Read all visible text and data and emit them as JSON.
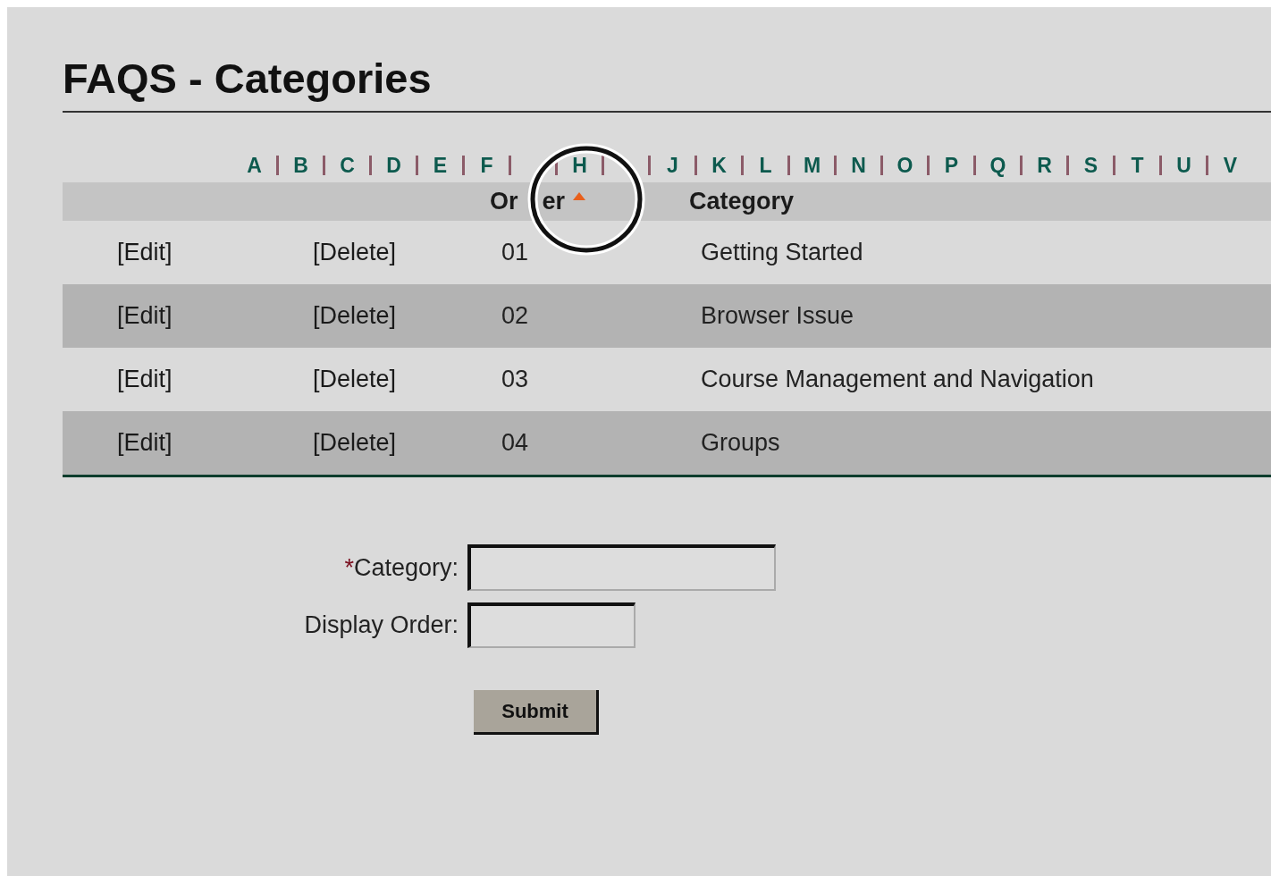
{
  "title": "FAQS - Categories",
  "letters": [
    {
      "label": "A",
      "covered": false
    },
    {
      "label": "B",
      "covered": false
    },
    {
      "label": "C",
      "covered": false
    },
    {
      "label": "D",
      "covered": false
    },
    {
      "label": "E",
      "covered": false
    },
    {
      "label": "F",
      "covered": false
    },
    {
      "covered": true
    },
    {
      "label": "H",
      "covered": false
    },
    {
      "covered": true
    },
    {
      "label": "J",
      "covered": false
    },
    {
      "label": "K",
      "covered": false
    },
    {
      "label": "L",
      "covered": false
    },
    {
      "label": "M",
      "covered": false
    },
    {
      "label": "N",
      "covered": false
    },
    {
      "label": "O",
      "covered": false
    },
    {
      "label": "P",
      "covered": false
    },
    {
      "label": "Q",
      "covered": false
    },
    {
      "label": "R",
      "covered": false
    },
    {
      "label": "S",
      "covered": false
    },
    {
      "label": "T",
      "covered": false
    },
    {
      "label": "U",
      "covered": false
    },
    {
      "label": "V",
      "covered": false
    }
  ],
  "table": {
    "columns": [
      {
        "label": "Or",
        "label_end": "er",
        "sorted": true
      },
      {
        "label": "Category",
        "sorted": false
      }
    ],
    "rows": [
      {
        "edit": "[Edit]",
        "delete": "[Delete]",
        "order": "01",
        "category": "Getting Started"
      },
      {
        "edit": "[Edit]",
        "delete": "[Delete]",
        "order": "02",
        "category": "Browser Issue"
      },
      {
        "edit": "[Edit]",
        "delete": "[Delete]",
        "order": "03",
        "category": "Course Management and Navigation"
      },
      {
        "edit": "[Edit]",
        "delete": "[Delete]",
        "order": "04",
        "category": "Groups"
      }
    ]
  },
  "form": {
    "fields": [
      {
        "mark": "*",
        "label": "Category:",
        "kind": "text"
      },
      {
        "label": "Display Order:",
        "kind": "number"
      }
    ],
    "submit": "Submit"
  }
}
